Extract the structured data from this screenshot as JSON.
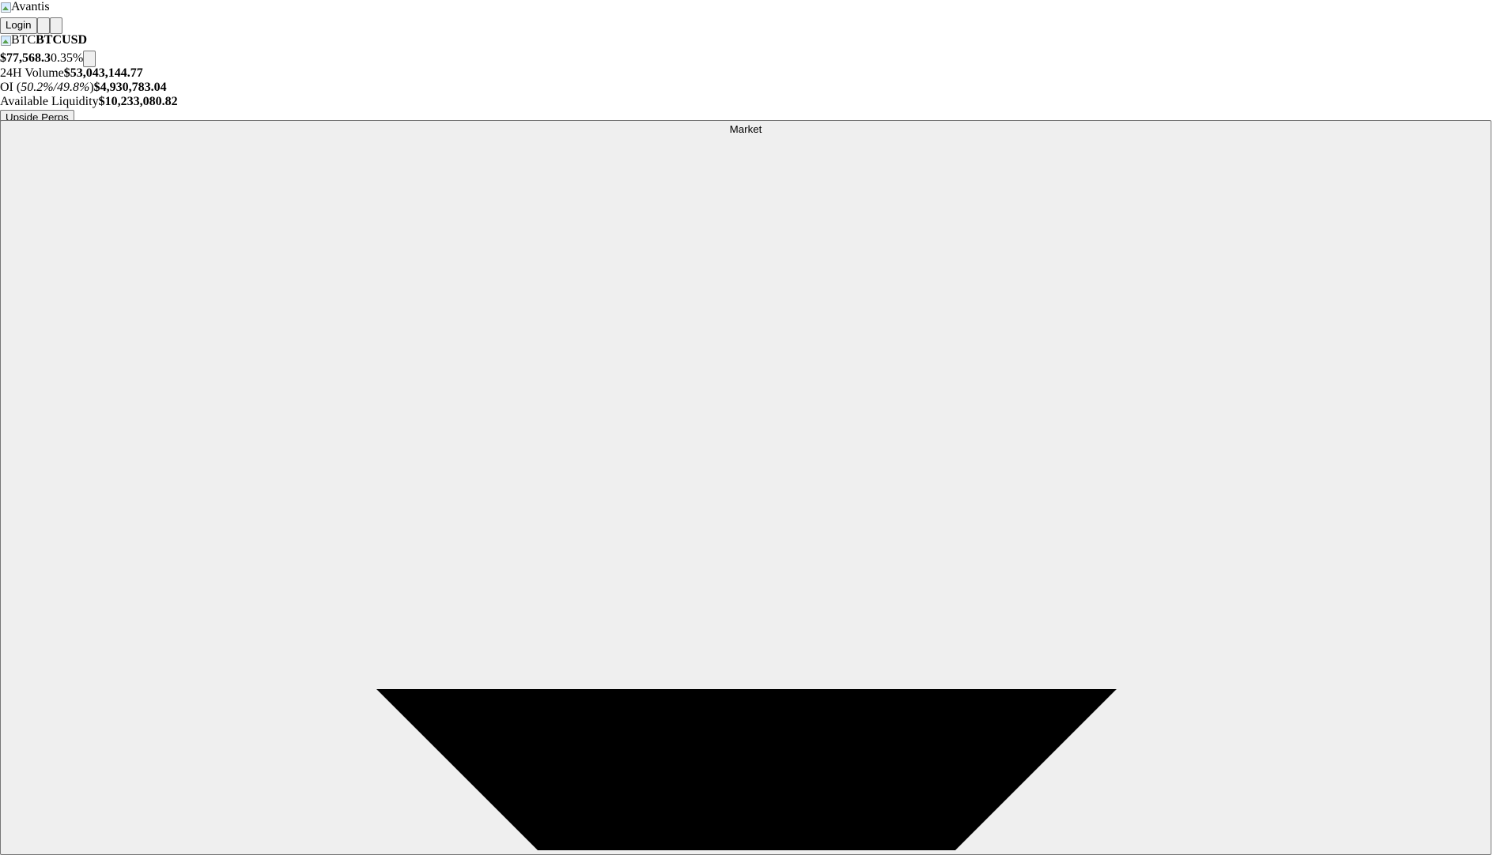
{
  "brand": {
    "logo_alt": "Avantis"
  },
  "header": {
    "login_label": "Login"
  },
  "market": {
    "icon_alt": "BTC",
    "pair": "BTCUSD",
    "price": "$77,568.3",
    "change": "0.35%"
  },
  "stats": {
    "volume_label": "24H Volume",
    "volume_value": "$53,043,144.77",
    "oi_label_prefix": "OI (",
    "oi_long": "50.2%",
    "oi_sep": "/",
    "oi_short": "49.8%",
    "oi_label_suffix": ")",
    "oi_value": "$4,930,783.04",
    "liquidity_label": "Available Liquidity",
    "liquidity_value": "$10,233,080.82"
  },
  "buttons": {
    "upside_perps": "Upside Perps",
    "market_select": "Market"
  },
  "icons": {
    "dropdown": "triangle-down-icon"
  }
}
